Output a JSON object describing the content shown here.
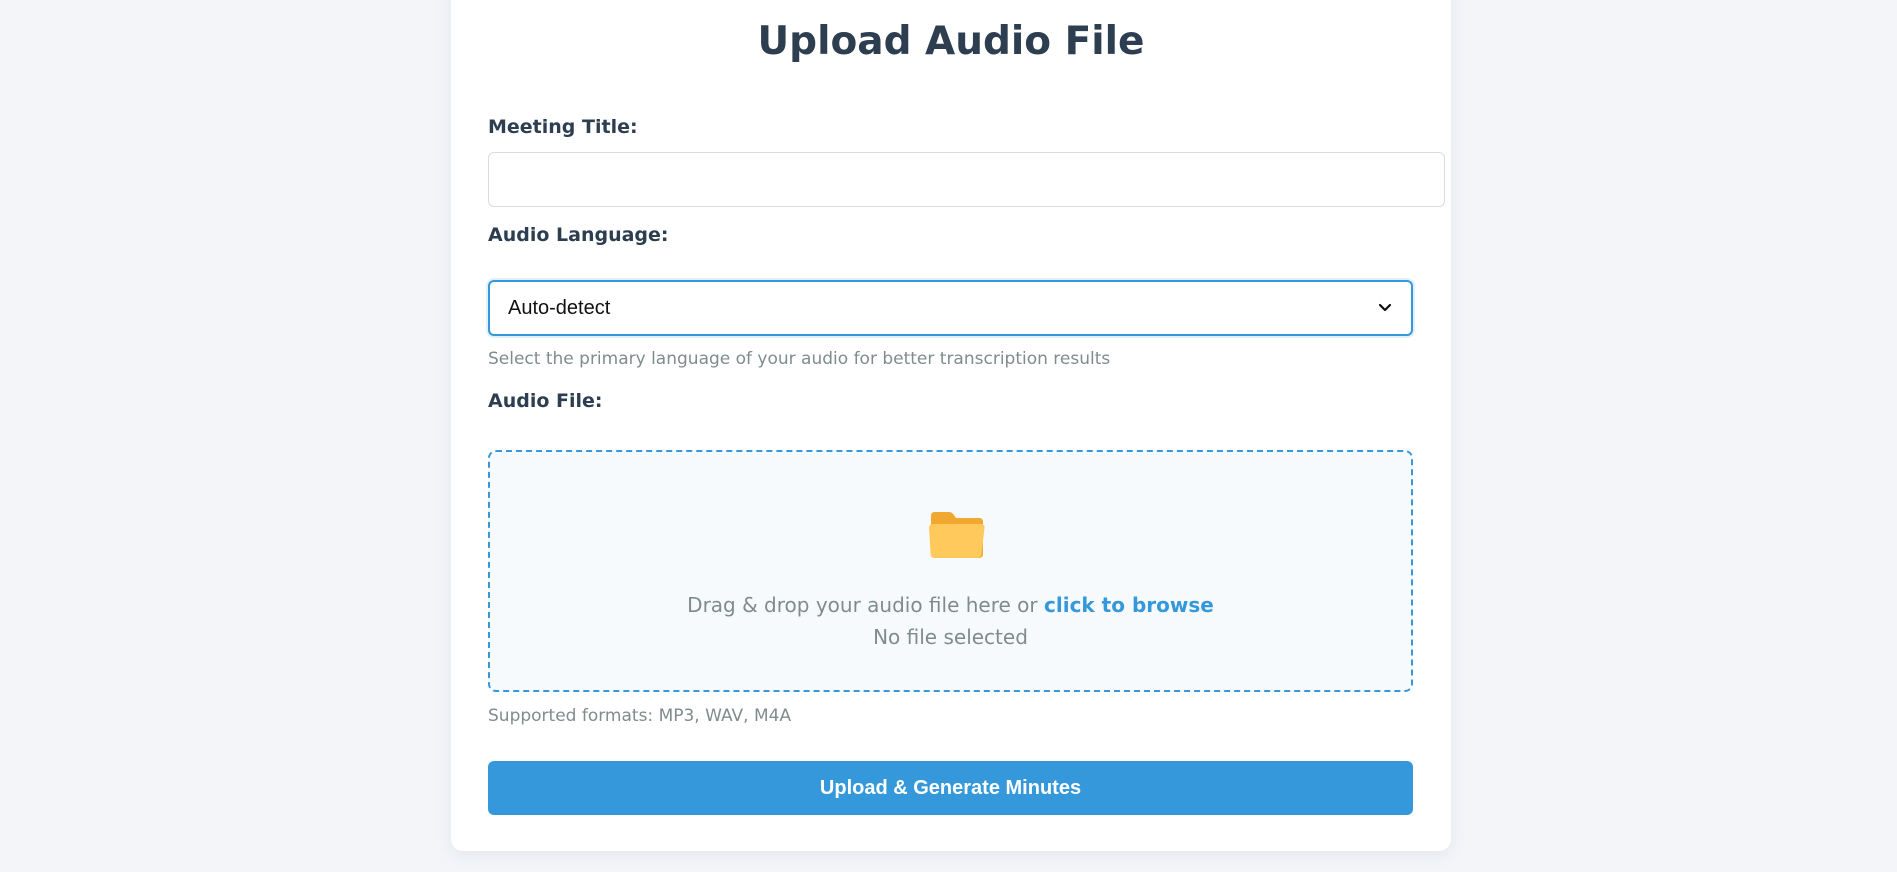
{
  "page": {
    "title": "Upload Audio File"
  },
  "form": {
    "meeting_title": {
      "label": "Meeting Title:",
      "value": "",
      "placeholder": ""
    },
    "language": {
      "label": "Audio Language:",
      "selected": "Auto-detect",
      "hint": "Select the primary language of your audio for better transcription results"
    },
    "audio_file": {
      "label": "Audio File:",
      "drop_prefix": "Drag & drop your audio file here or ",
      "browse_link": "click to browse",
      "status": "No file selected",
      "formats": "Supported formats: MP3, WAV, M4A",
      "icon": "folder-icon"
    },
    "submit_label": "Upload & Generate Minutes"
  },
  "colors": {
    "accent": "#3498db",
    "heading": "#2c3e50",
    "muted": "#7f8c8d",
    "background": "#f3f5f9"
  }
}
